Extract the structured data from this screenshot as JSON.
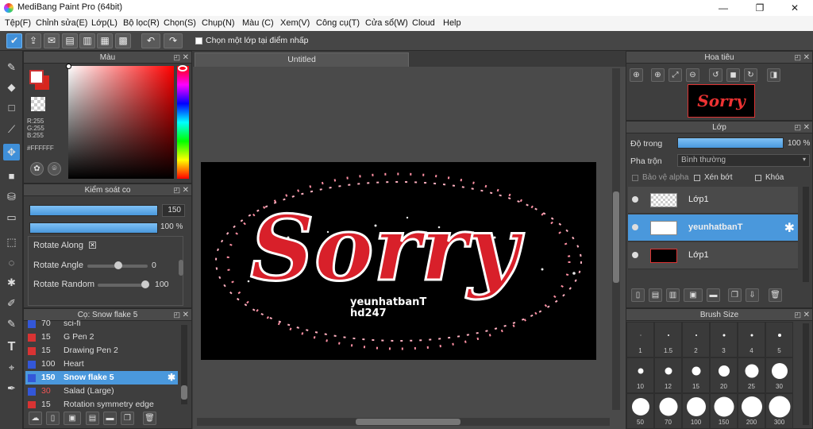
{
  "window": {
    "title": "MediBang Paint Pro (64bit)",
    "minimize": "—",
    "restore": "❐",
    "close": "✕"
  },
  "menu": [
    "Tệp(F)",
    "Chỉnh sửa(E)",
    "Lớp(L)",
    "Bộ lọc(R)",
    "Chọn(S)",
    "Chụp(N)",
    "Màu (C)",
    "Xem(V)",
    "Công cụ(T)",
    "Cửa sổ(W)",
    "Cloud",
    "Help"
  ],
  "toolbar": {
    "select_layer_label": "Chọn một lớp tại điểm nhấp"
  },
  "color_panel": {
    "title": "Màu",
    "r": "R:255",
    "g": "G:255",
    "b": "B:255",
    "hex": "#FFFFFF",
    "primary": "#ffffff",
    "secondary": "#d7261e"
  },
  "control_panel": {
    "title": "Kiểm soát co",
    "size_value": "150",
    "opacity_value": "100 %",
    "rotate_along": "Rotate Along",
    "rotate_angle": "Rotate Angle",
    "rotate_angle_value": "0",
    "rotate_random": "Rotate Random",
    "rotate_random_value": "100"
  },
  "brush_panel": {
    "title": "Cọ: Snow flake 5",
    "items": [
      {
        "color": "#3357d8",
        "size": "70",
        "name": "sci-fi"
      },
      {
        "color": "#d83333",
        "size": "15",
        "name": "G Pen 2"
      },
      {
        "color": "#d83333",
        "size": "15",
        "name": "Drawing Pen 2"
      },
      {
        "color": "#3357d8",
        "size": "100",
        "name": "Heart"
      },
      {
        "color": "#3357d8",
        "size": "150",
        "name": "Snow flake 5"
      },
      {
        "color": "#3357d8",
        "size": "30",
        "name": "Salad (Large)"
      },
      {
        "color": "#d83333",
        "size": "15",
        "name": "Rotation symmetry edge"
      }
    ]
  },
  "canvas": {
    "tab": "Untitled",
    "art_text": "Sorry",
    "signature_1": "yeunhatbanT",
    "signature_2": "hd247"
  },
  "navigator": {
    "title": "Hoa tiêu",
    "thumb_text": "Sorry"
  },
  "layer_panel": {
    "title": "Lớp",
    "opacity_label": "Độ trong",
    "opacity_value": "100 %",
    "blend_label": "Pha trộn",
    "blend_value": "Bình thường",
    "protect_alpha": "Bảo vệ alpha",
    "clipping": "Xén bớt",
    "lock": "Khóa",
    "layers": [
      "Lớp1",
      "yeunhatbanT",
      "Lớp1"
    ]
  },
  "brush_size": {
    "title": "Brush Size",
    "row1": [
      "1",
      "1.5",
      "2",
      "3",
      "4",
      "5"
    ],
    "row2": [
      "10",
      "12",
      "15",
      "20",
      "25",
      "30"
    ],
    "row3": [
      "50",
      "70",
      "100",
      "150",
      "200",
      "300"
    ]
  }
}
